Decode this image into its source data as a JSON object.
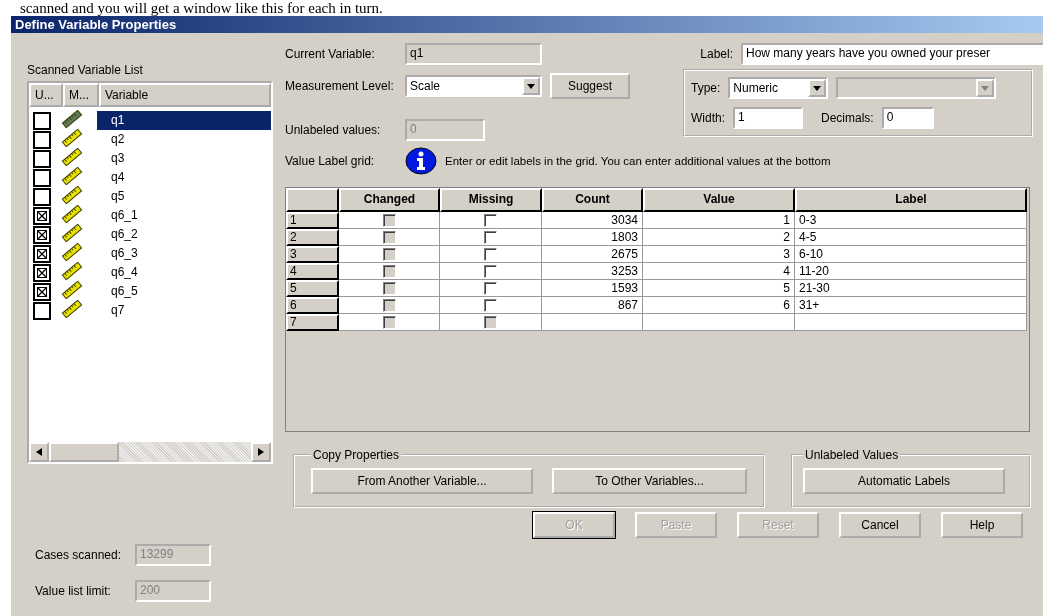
{
  "caption": "scanned and you will get a window like this for each in turn.",
  "window": {
    "title": "Define Variable Properties"
  },
  "scanned_list": {
    "title": "Scanned Variable List",
    "columns": [
      "U...",
      "M...",
      "Variable"
    ],
    "items": [
      {
        "name": "q1",
        "checked": false,
        "selected": true
      },
      {
        "name": "q2",
        "checked": false,
        "selected": false
      },
      {
        "name": "q3",
        "checked": false,
        "selected": false
      },
      {
        "name": "q4",
        "checked": false,
        "selected": false
      },
      {
        "name": "q5",
        "checked": false,
        "selected": false
      },
      {
        "name": "q6_1",
        "checked": true,
        "selected": false
      },
      {
        "name": "q6_2",
        "checked": true,
        "selected": false
      },
      {
        "name": "q6_3",
        "checked": true,
        "selected": false
      },
      {
        "name": "q6_4",
        "checked": true,
        "selected": false
      },
      {
        "name": "q6_5",
        "checked": true,
        "selected": false
      },
      {
        "name": "q7",
        "checked": false,
        "selected": false
      }
    ]
  },
  "cases_scanned": {
    "label": "Cases scanned:",
    "value": "13299"
  },
  "value_list_limit": {
    "label": "Value list limit:",
    "value": "200"
  },
  "current_variable": {
    "label": "Current Variable:",
    "value": "q1"
  },
  "label_field": {
    "label": "Label:",
    "value": "How many years have you owned your preser"
  },
  "measurement_level": {
    "label": "Measurement Level:",
    "value": "Scale"
  },
  "suggest_button": "Suggest",
  "unlabeled_values_field": {
    "label": "Unlabeled values:",
    "value": "0"
  },
  "type": {
    "label": "Type:",
    "value": "Numeric"
  },
  "width": {
    "label": "Width:",
    "value": "1"
  },
  "decimals": {
    "label": "Decimals:",
    "value": "0"
  },
  "grid_hint": {
    "label": "Value Label grid:",
    "text": "Enter or edit labels in the grid.  You can enter additional values at the bottom"
  },
  "table": {
    "columns": [
      "Changed",
      "Missing",
      "Count",
      "Value",
      "Label"
    ],
    "rows": [
      {
        "row": "1",
        "changed_disabled": true,
        "missing_disabled": false,
        "count": "3034",
        "code": "1",
        "code_label": "0-3"
      },
      {
        "row": "2",
        "changed_disabled": true,
        "missing_disabled": false,
        "count": "1803",
        "code": "2",
        "code_label": "4-5"
      },
      {
        "row": "3",
        "changed_disabled": true,
        "missing_disabled": false,
        "count": "2675",
        "code": "3",
        "code_label": "6-10"
      },
      {
        "row": "4",
        "changed_disabled": true,
        "missing_disabled": false,
        "count": "3253",
        "code": "4",
        "code_label": "11-20"
      },
      {
        "row": "5",
        "changed_disabled": true,
        "missing_disabled": false,
        "count": "1593",
        "code": "5",
        "code_label": "21-30"
      },
      {
        "row": "6",
        "changed_disabled": true,
        "missing_disabled": false,
        "count": "867",
        "code": "6",
        "code_label": "31+"
      },
      {
        "row": "7",
        "changed_disabled": true,
        "missing_disabled": true,
        "count": "",
        "code": "",
        "code_label": ""
      }
    ]
  },
  "copy_properties": {
    "title": "Copy Properties",
    "buttons": [
      "From Another Variable...",
      "To Other Variables..."
    ]
  },
  "unlabeled_values_group": {
    "title": "Unlabeled Values",
    "button": "Automatic Labels"
  },
  "buttons": [
    {
      "label": "OK",
      "disabled": true,
      "default": true
    },
    {
      "label": "Paste",
      "disabled": true,
      "default": false
    },
    {
      "label": "Reset",
      "disabled": true,
      "default": false
    },
    {
      "label": "Cancel",
      "disabled": false,
      "default": false
    },
    {
      "label": "Help",
      "disabled": false,
      "default": false
    }
  ]
}
